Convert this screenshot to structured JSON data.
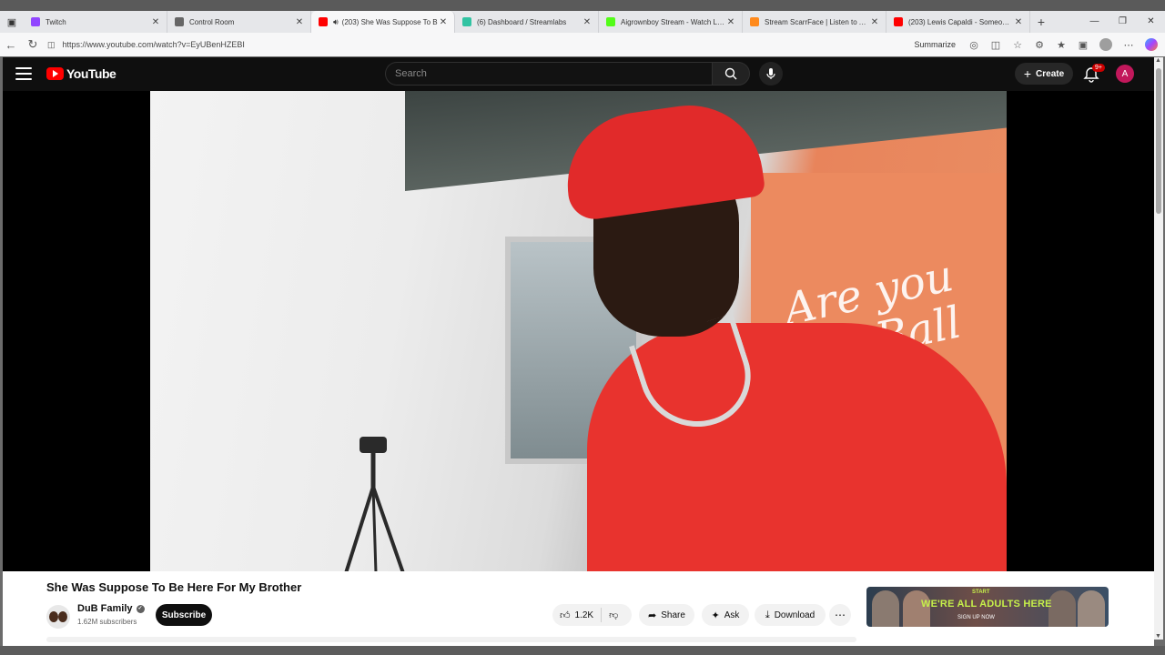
{
  "browser": {
    "tabs": [
      {
        "title": "Twitch",
        "favicon": "twitch-icon",
        "color": "#9146ff"
      },
      {
        "title": "Control Room",
        "favicon": "control-room-icon",
        "color": "#666666"
      },
      {
        "title": "(203) She Was Suppose To B",
        "favicon": "youtube-icon",
        "color": "#ff0000",
        "active": true
      },
      {
        "title": "(6) Dashboard / Streamlabs",
        "favicon": "streamlabs-icon",
        "color": "#31c3a2"
      },
      {
        "title": "Aigrownboy Stream - Watch Live",
        "favicon": "kick-icon",
        "color": "#53fc18"
      },
      {
        "title": "Stream ScarrFace | Listen to Afri",
        "favicon": "audiomack-icon",
        "color": "#ff8a1c"
      },
      {
        "title": "(203) Lewis Capaldi - Someone Y",
        "favicon": "youtube-icon",
        "color": "#ff0000"
      }
    ],
    "url": "https://www.youtube.com/watch?v=EyUBenHZEBI",
    "summarize_label": "Summarize"
  },
  "youtube": {
    "logo_text": "YouTube",
    "search_placeholder": "Search",
    "create_label": "Create",
    "notification_badge": "9+",
    "avatar_letter": "A"
  },
  "video": {
    "title": "She Was Suppose To Be Here For My Brother",
    "channel_name": "DuB Family",
    "subscribers": "1.62M subscribers",
    "subscribe_label": "Subscribe",
    "likes": "1.2K",
    "share_label": "Share",
    "ask_label": "Ask",
    "download_label": "Download",
    "banner_text": "Are you My Ball"
  },
  "ad": {
    "headline": "WE'RE ALL ADULTS HERE",
    "cta": "SIGN UP NOW",
    "top_text": "START"
  },
  "colors": {
    "youtube_red": "#ff0000",
    "header_bg": "#0f0f0f",
    "avatar_bg": "#c2185b",
    "ad_headline": "#c6f04a"
  }
}
